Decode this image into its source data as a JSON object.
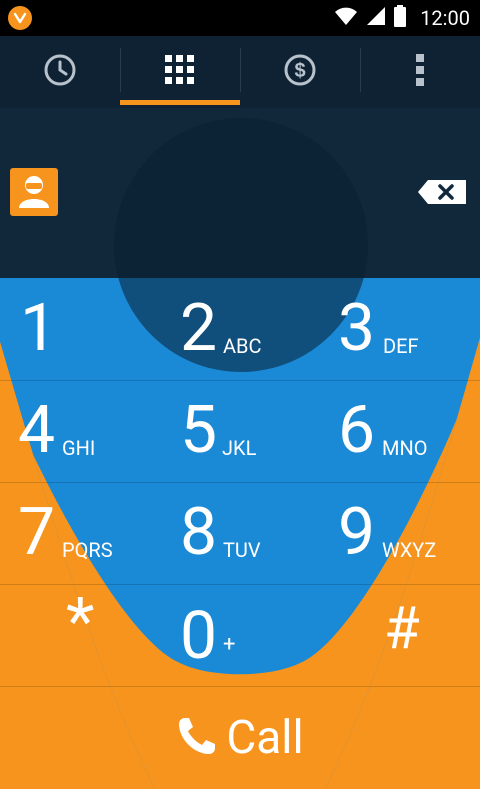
{
  "status": {
    "time": "12:00",
    "icons": [
      "app-logo-icon",
      "wifi-icon",
      "signal-icon",
      "battery-icon"
    ]
  },
  "tabs": [
    {
      "name": "tab-history",
      "icon": "clock-icon",
      "active": false
    },
    {
      "name": "tab-keypad",
      "icon": "keypad-icon",
      "active": true
    },
    {
      "name": "tab-credit",
      "icon": "dollar-icon",
      "active": false
    },
    {
      "name": "tab-more",
      "icon": "overflow-icon",
      "active": false
    }
  ],
  "number_display": {
    "contact_icon": "contact-icon",
    "backspace_icon": "backspace-icon"
  },
  "keys": [
    {
      "digit": "1",
      "letters": ""
    },
    {
      "digit": "2",
      "letters": "ABC"
    },
    {
      "digit": "3",
      "letters": "DEF"
    },
    {
      "digit": "4",
      "letters": "GHI"
    },
    {
      "digit": "5",
      "letters": "JKL"
    },
    {
      "digit": "6",
      "letters": "MNO"
    },
    {
      "digit": "7",
      "letters": "PQRS"
    },
    {
      "digit": "8",
      "letters": "TUV"
    },
    {
      "digit": "9",
      "letters": "WXYZ"
    },
    {
      "digit": "*",
      "letters": ""
    },
    {
      "digit": "0",
      "letters": "+"
    },
    {
      "digit": "#",
      "letters": ""
    }
  ],
  "call": {
    "label": "Call",
    "icon": "phone-icon"
  },
  "colors": {
    "accent": "#f7941d",
    "keypad": "#1a89d6",
    "header": "#0e2233",
    "display": "#11283b"
  }
}
